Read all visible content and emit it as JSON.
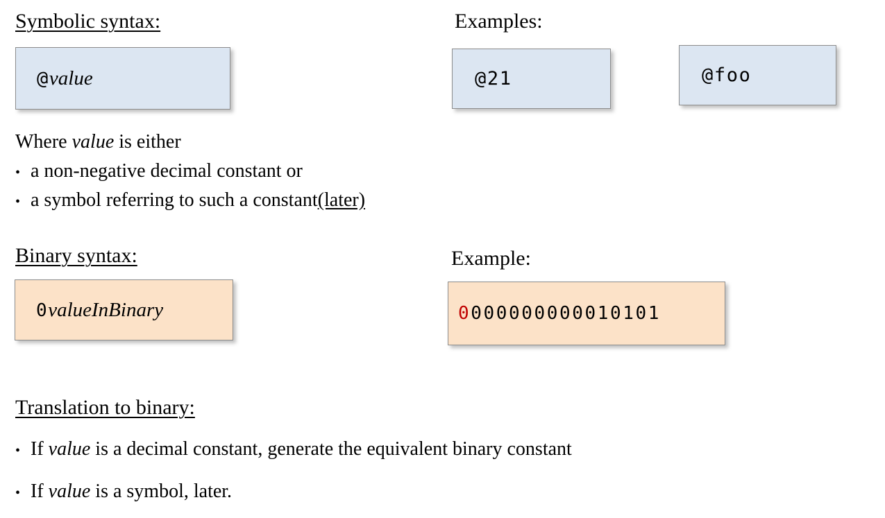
{
  "slide": {
    "background_color": "#ffffff",
    "text_color": "#000000",
    "accent_red": "#c00000",
    "box_blue_fill": "#dce6f2",
    "box_orange_fill": "#fce2c8",
    "box_border": "#8c8c8c"
  },
  "symbolic_section": {
    "heading": "Symbolic syntax:",
    "syntax_box": {
      "prefix": "@",
      "placeholder": "value"
    },
    "examples_heading": "Examples:",
    "examples": [
      {
        "text": "@21"
      },
      {
        "text": "@foo"
      }
    ]
  },
  "where_clause": {
    "intro_before": "Where ",
    "intro_italic": "value",
    "intro_after": " is either",
    "bullet_marker": "•",
    "bullets": [
      {
        "text": "a non-negative decimal constant or",
        "link": ""
      },
      {
        "text": "a symbol referring to such a constant ",
        "link": "(later)"
      }
    ]
  },
  "binary_section": {
    "heading": "Binary syntax:",
    "syntax_box": {
      "prefix": "0",
      "placeholder": "valueInBinary"
    },
    "example_heading": "Example:",
    "example_box": {
      "opcode_bit": "0",
      "value_bits": "000000000010101",
      "full_word": "0000000000010101"
    }
  },
  "translation_section": {
    "heading": "Translation to binary:",
    "bullet_marker": "•",
    "bullets": [
      {
        "before": "If ",
        "italic": "value",
        "after": " is a decimal constant, generate the equivalent binary constant"
      },
      {
        "before": "If ",
        "italic": "value",
        "after": " is a symbol, later."
      }
    ]
  }
}
